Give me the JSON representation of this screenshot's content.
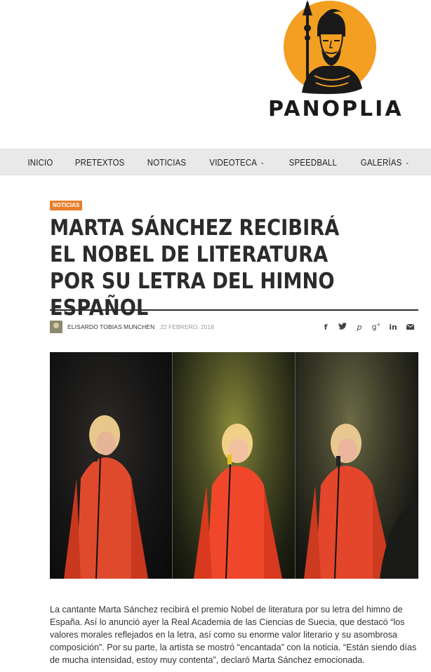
{
  "site": {
    "logo_text": "PANOPLIA",
    "colors": {
      "logo_orange": "#F29F22",
      "accent": "#E87D2A",
      "text_dark": "#2B2B2B",
      "nav_bg": "#E9E9E9"
    }
  },
  "nav": {
    "items": [
      {
        "label": "INICIO",
        "dropdown": false
      },
      {
        "label": "PRETEXTOS",
        "dropdown": false
      },
      {
        "label": "NOTICIAS",
        "dropdown": false
      },
      {
        "label": "VIDEOTECA",
        "dropdown": true
      },
      {
        "label": "SPEEDBALL",
        "dropdown": false
      },
      {
        "label": "GALERÍAS",
        "dropdown": true
      }
    ]
  },
  "article": {
    "category": "NOTICIAS",
    "title": "MARTA SÁNCHEZ RECIBIRÁ EL NOBEL DE LITERATURA POR SU LETRA DEL HIMNO ESPAÑOL",
    "author": "ELISARDO TOBIAS MUNCHEN",
    "date": "22 FEBRERO, 2018",
    "share_icons": [
      "facebook-icon",
      "twitter-icon",
      "pinterest-icon",
      "google-plus-icon",
      "linkedin-icon",
      "email-icon"
    ],
    "body": "La cantante Marta Sánchez recibirá el premio Nobel de literatura por su letra del himno de España. Así lo anunció ayer la Real Academia de las Ciencias de Suecia, que destacó “los valores morales reflejados en la letra, así como su enorme valor literario y su asombrosa composición”. Por su parte, la artista se mostró “encantada” con la noticia. “Están siendo días de mucha intensidad, estoy muy contenta”, declaró Marta Sánchez emocionada."
  }
}
